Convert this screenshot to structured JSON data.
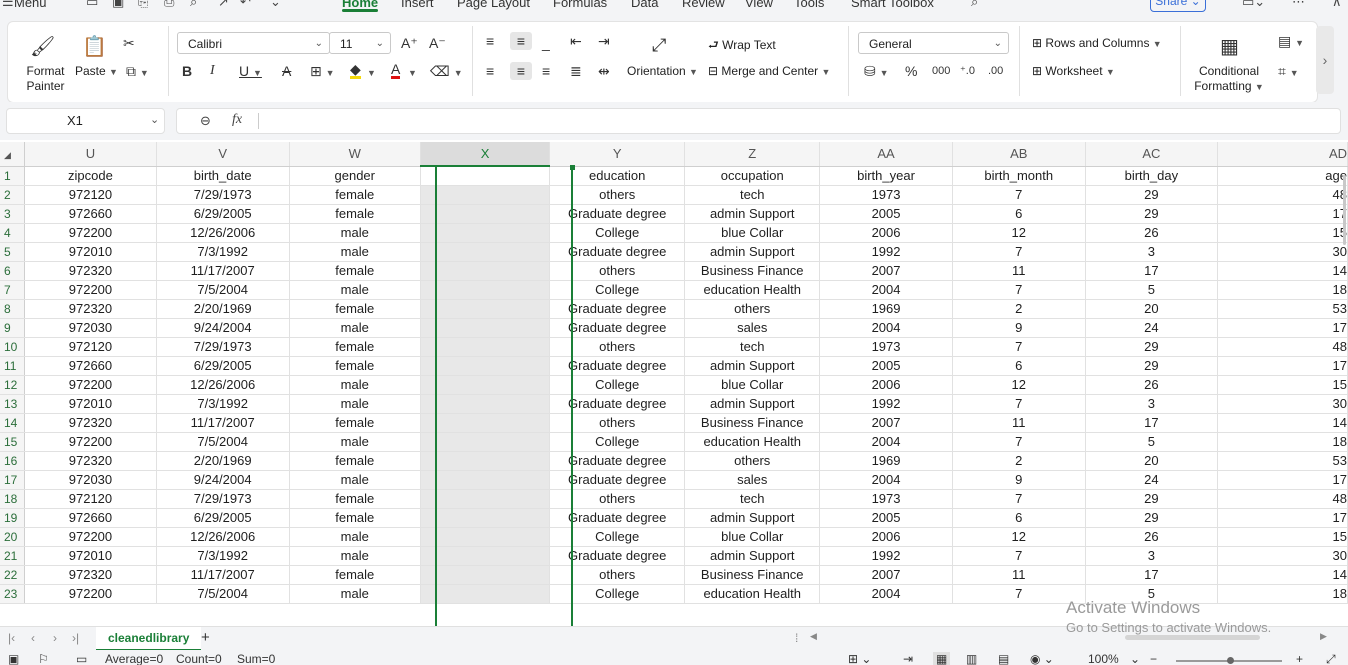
{
  "menubar": {
    "menu": "Menu",
    "tabs": [
      "Home",
      "Insert",
      "Page Layout",
      "Formulas",
      "Data",
      "Review",
      "View",
      "Tools",
      "Smart Toolbox"
    ],
    "active_tab": "Home",
    "share": "Share"
  },
  "ribbon": {
    "format_painter": "Format Painter",
    "paste": "Paste",
    "font_name": "Calibri",
    "font_size": "11",
    "wrap_text": "Wrap Text",
    "merge_center": "Merge and Center",
    "orientation": "Orientation",
    "number_format": "General",
    "rows_columns": "Rows and Columns",
    "worksheet": "Worksheet",
    "conditional_formatting": "Conditional Formatting"
  },
  "formula_bar": {
    "name_box": "X1",
    "fx": "fx",
    "formula": ""
  },
  "grid": {
    "columns": [
      "U",
      "V",
      "W",
      "X",
      "Y",
      "Z",
      "AA",
      "AB",
      "AC",
      "AD"
    ],
    "selected_column": "X",
    "row_numbers": [
      "1",
      "2",
      "3",
      "4",
      "5",
      "6",
      "7",
      "8",
      "9",
      "10",
      "11",
      "12",
      "13",
      "14",
      "15",
      "16",
      "17",
      "18",
      "19",
      "20",
      "21",
      "22",
      "23"
    ],
    "rows": [
      [
        "zipcode",
        "birth_date",
        "gender",
        "",
        "education",
        "occupation",
        "birth_year",
        "birth_month",
        "birth_day",
        "age"
      ],
      [
        "972120",
        "7/29/1973",
        "female",
        "",
        "others",
        "tech",
        "1973",
        "7",
        "29",
        "48"
      ],
      [
        "972660",
        "6/29/2005",
        "female",
        "",
        "Graduate degree",
        "admin Support",
        "2005",
        "6",
        "29",
        "17"
      ],
      [
        "972200",
        "12/26/2006",
        "male",
        "",
        "College",
        "blue Collar",
        "2006",
        "12",
        "26",
        "15"
      ],
      [
        "972010",
        "7/3/1992",
        "male",
        "",
        "Graduate degree",
        "admin Support",
        "1992",
        "7",
        "3",
        "30"
      ],
      [
        "972320",
        "11/17/2007",
        "female",
        "",
        "others",
        "Business Finance",
        "2007",
        "11",
        "17",
        "14"
      ],
      [
        "972200",
        "7/5/2004",
        "male",
        "",
        "College",
        "education Health",
        "2004",
        "7",
        "5",
        "18"
      ],
      [
        "972320",
        "2/20/1969",
        "female",
        "",
        "Graduate degree",
        "others",
        "1969",
        "2",
        "20",
        "53"
      ],
      [
        "972030",
        "9/24/2004",
        "male",
        "",
        "Graduate degree",
        "sales",
        "2004",
        "9",
        "24",
        "17"
      ],
      [
        "972120",
        "7/29/1973",
        "female",
        "",
        "others",
        "tech",
        "1973",
        "7",
        "29",
        "48"
      ],
      [
        "972660",
        "6/29/2005",
        "female",
        "",
        "Graduate degree",
        "admin Support",
        "2005",
        "6",
        "29",
        "17"
      ],
      [
        "972200",
        "12/26/2006",
        "male",
        "",
        "College",
        "blue Collar",
        "2006",
        "12",
        "26",
        "15"
      ],
      [
        "972010",
        "7/3/1992",
        "male",
        "",
        "Graduate degree",
        "admin Support",
        "1992",
        "7",
        "3",
        "30"
      ],
      [
        "972320",
        "11/17/2007",
        "female",
        "",
        "others",
        "Business Finance",
        "2007",
        "11",
        "17",
        "14"
      ],
      [
        "972200",
        "7/5/2004",
        "male",
        "",
        "College",
        "education Health",
        "2004",
        "7",
        "5",
        "18"
      ],
      [
        "972320",
        "2/20/1969",
        "female",
        "",
        "Graduate degree",
        "others",
        "1969",
        "2",
        "20",
        "53"
      ],
      [
        "972030",
        "9/24/2004",
        "male",
        "",
        "Graduate degree",
        "sales",
        "2004",
        "9",
        "24",
        "17"
      ],
      [
        "972120",
        "7/29/1973",
        "female",
        "",
        "others",
        "tech",
        "1973",
        "7",
        "29",
        "48"
      ],
      [
        "972660",
        "6/29/2005",
        "female",
        "",
        "Graduate degree",
        "admin Support",
        "2005",
        "6",
        "29",
        "17"
      ],
      [
        "972200",
        "12/26/2006",
        "male",
        "",
        "College",
        "blue Collar",
        "2006",
        "12",
        "26",
        "15"
      ],
      [
        "972010",
        "7/3/1992",
        "male",
        "",
        "Graduate degree",
        "admin Support",
        "1992",
        "7",
        "3",
        "30"
      ],
      [
        "972320",
        "11/17/2007",
        "female",
        "",
        "others",
        "Business Finance",
        "2007",
        "11",
        "17",
        "14"
      ],
      [
        "972200",
        "7/5/2004",
        "male",
        "",
        "College",
        "education Health",
        "2004",
        "7",
        "5",
        "18"
      ]
    ]
  },
  "sheet_tabs": {
    "active": "cleanedlibrary",
    "add": "+"
  },
  "status_bar": {
    "average": "Average=0",
    "count": "Count=0",
    "sum": "Sum=0",
    "zoom": "100%"
  },
  "watermark": {
    "line1": "Activate Windows",
    "line2": "Go to Settings to activate Windows."
  },
  "colors": {
    "accent": "#1a7f37",
    "chrome": "#f3f4f6",
    "selected_column": "#e8e8e8"
  }
}
